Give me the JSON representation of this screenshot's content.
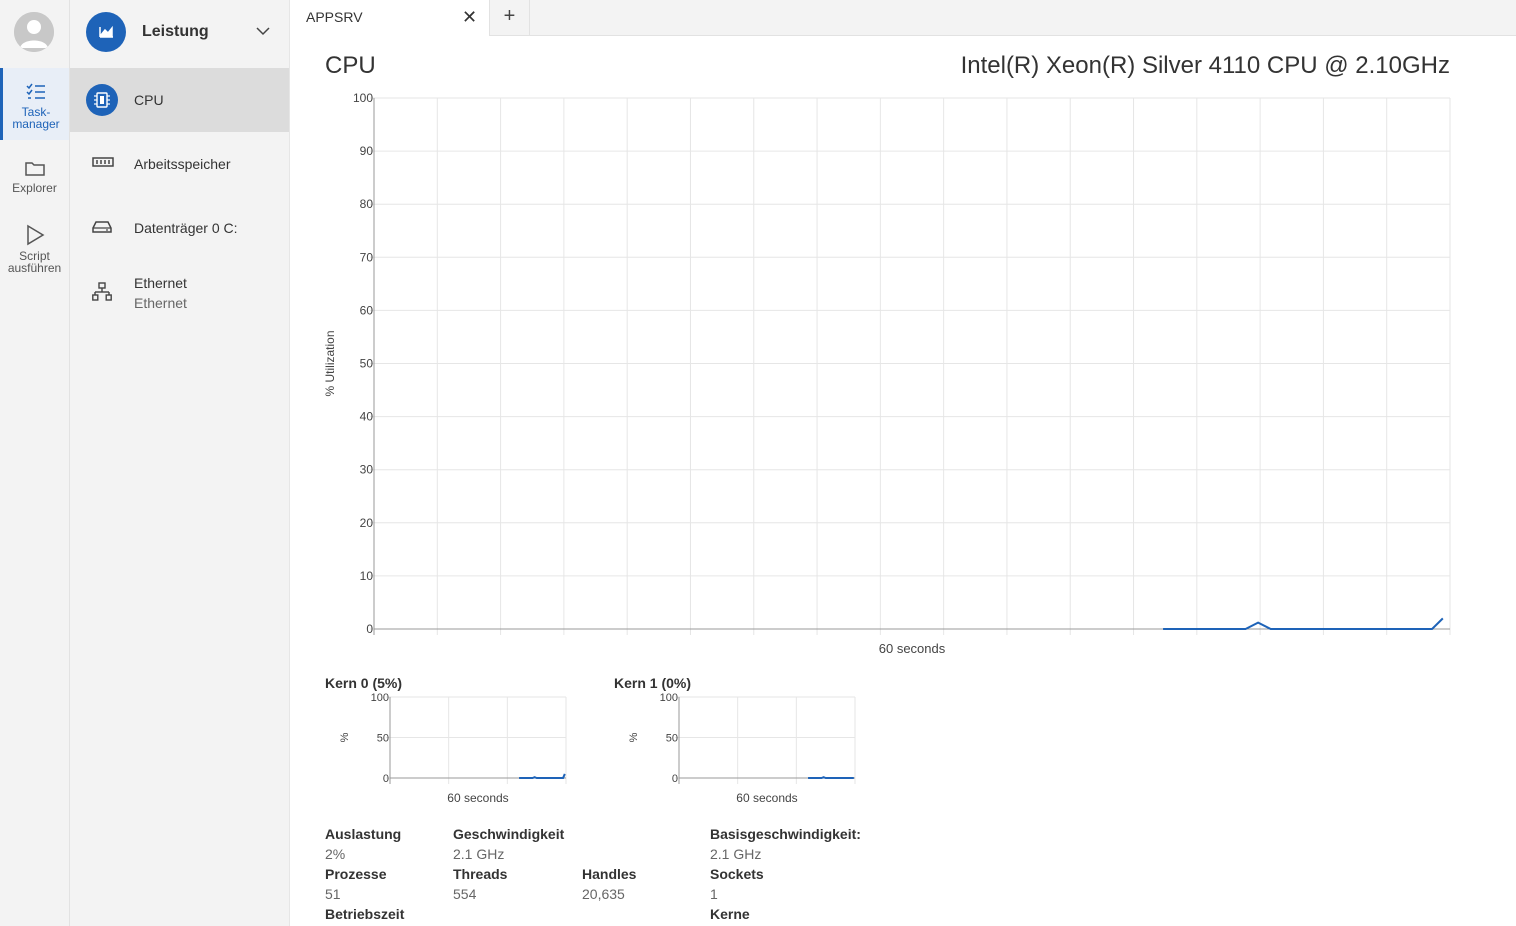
{
  "rail": {
    "items": [
      {
        "label_line1": "Task-",
        "label_line2": "manager",
        "icon": "task-list-icon"
      },
      {
        "label_line1": "Explorer",
        "label_line2": "",
        "icon": "folder-icon"
      },
      {
        "label_line1": "Script",
        "label_line2": "ausführen",
        "icon": "play-icon"
      }
    ]
  },
  "nav": {
    "header": {
      "label": "Leistung",
      "icon": "performance-icon"
    },
    "items": [
      {
        "label": "CPU",
        "sub": "",
        "icon": "cpu-chip-icon"
      },
      {
        "label": "Arbeitsspeicher",
        "sub": "",
        "icon": "memory-icon"
      },
      {
        "label": "Datenträger 0 C:",
        "sub": "",
        "icon": "drive-icon"
      },
      {
        "label": "Ethernet",
        "sub": "Ethernet",
        "icon": "network-icon"
      }
    ]
  },
  "tabs": {
    "items": [
      {
        "label": "APPSRV"
      }
    ],
    "close_symbol": "✕",
    "add_symbol": "+"
  },
  "main": {
    "title": "CPU",
    "model": "Intel(R) Xeon(R) Silver 4110 CPU @ 2.10GHz"
  },
  "chart_data": [
    {
      "type": "line",
      "title": "",
      "xlabel": "60 seconds",
      "ylabel": "% Utilization",
      "ylim": [
        0,
        100
      ],
      "yticks": [
        0,
        10,
        20,
        30,
        40,
        50,
        60,
        70,
        80,
        90,
        100
      ],
      "xlim": [
        0,
        60
      ],
      "grid": true,
      "color": "#1e63b8",
      "x": [
        44,
        48.6,
        49.3,
        50,
        59,
        59.6
      ],
      "values": [
        0,
        0,
        1.2,
        0,
        0,
        2
      ]
    },
    {
      "type": "line",
      "title": "Kern 0 (5%)",
      "xlabel": "60 seconds",
      "ylabel": "%",
      "ylim": [
        0,
        100
      ],
      "yticks": [
        0,
        50,
        100
      ],
      "xlim": [
        0,
        60
      ],
      "grid": true,
      "color": "#1e63b8",
      "x": [
        44,
        48.6,
        49.3,
        50,
        59,
        59.6
      ],
      "values": [
        0,
        0,
        1,
        0,
        0,
        5
      ]
    },
    {
      "type": "line",
      "title": "Kern 1 (0%)",
      "xlabel": "60 seconds",
      "ylabel": "%",
      "ylim": [
        0,
        100
      ],
      "yticks": [
        0,
        50,
        100
      ],
      "xlim": [
        0,
        60
      ],
      "grid": true,
      "color": "#1e63b8",
      "x": [
        44,
        48.6,
        49.3,
        50,
        59.6
      ],
      "values": [
        0,
        0,
        1,
        0,
        0
      ]
    }
  ],
  "stats": {
    "auslastung": {
      "label": "Auslastung",
      "value": "2%"
    },
    "geschwindigkeit": {
      "label": "Geschwindigkeit",
      "value": "2.1 GHz"
    },
    "basisgeschwindigkeit": {
      "label": "Basisgeschwindigkeit:",
      "value": "2.1 GHz"
    },
    "prozesse": {
      "label": "Prozesse",
      "value": "51"
    },
    "threads": {
      "label": "Threads",
      "value": "554"
    },
    "handles": {
      "label": "Handles",
      "value": "20,635"
    },
    "sockets": {
      "label": "Sockets",
      "value": "1"
    },
    "betriebszeit": {
      "label": "Betriebszeit"
    },
    "kerne": {
      "label": "Kerne"
    }
  }
}
